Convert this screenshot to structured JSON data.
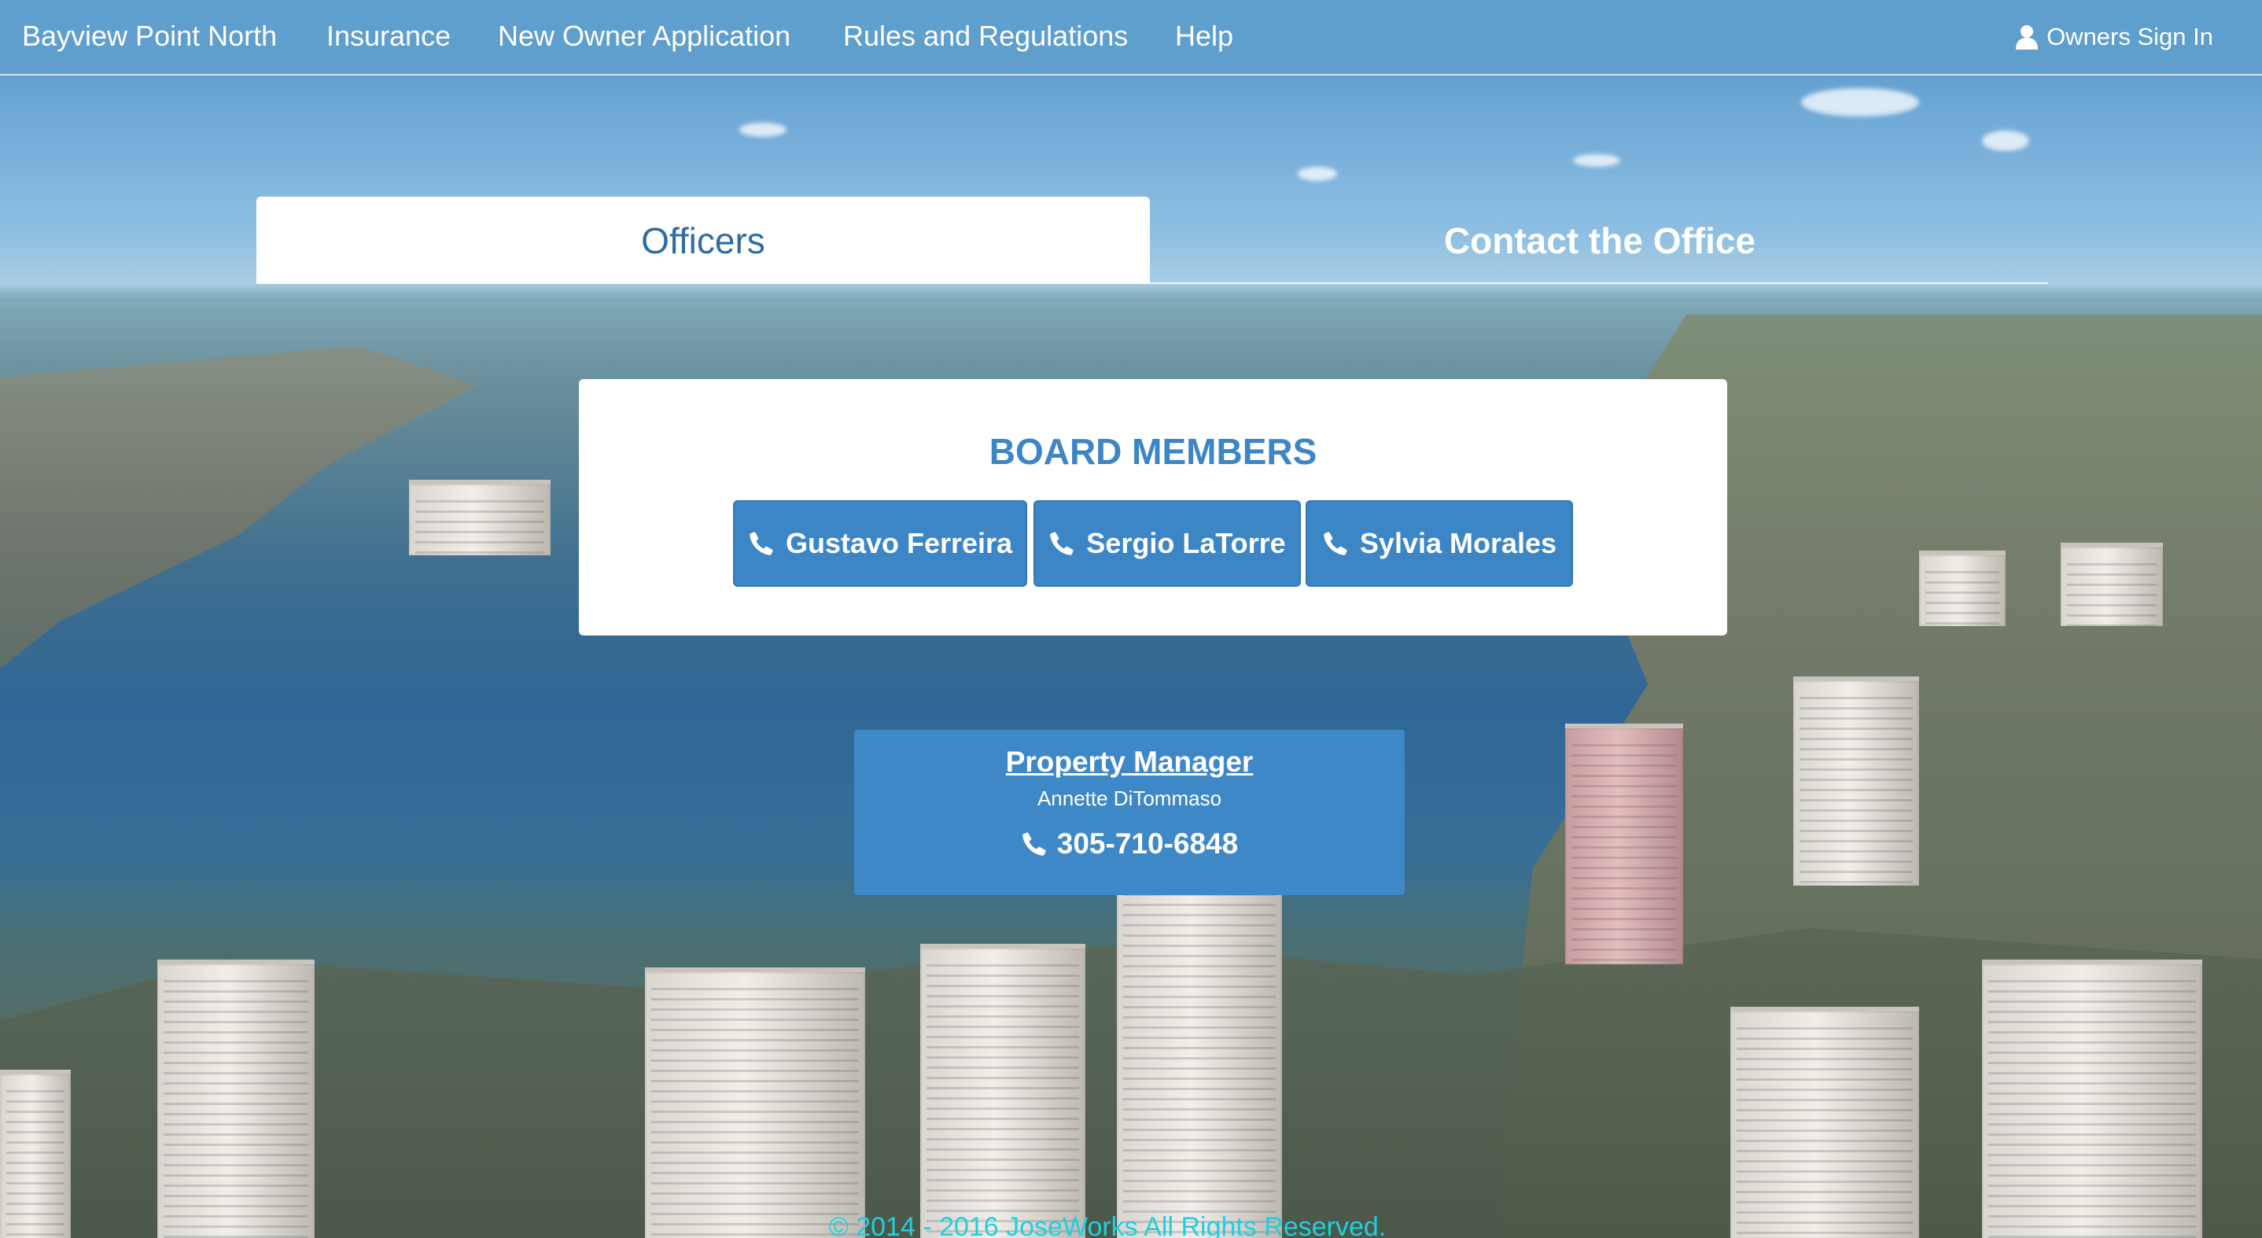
{
  "navbar": {
    "brand": "Bayview Point North",
    "links": [
      "Insurance",
      "New Owner Application",
      "Rules and Regulations",
      "Help"
    ],
    "signin_label": "Owners Sign In",
    "signin_icon": "user-icon",
    "background": "#5fa0cd"
  },
  "tabs": {
    "active": "Officers",
    "inactive": "Contact the Office"
  },
  "board": {
    "title": "BOARD MEMBERS",
    "members": [
      "Gustavo Ferreira",
      "Sergio LaTorre",
      "Sylvia Morales"
    ],
    "button_icon": "phone-icon",
    "accent": "#3c86c6"
  },
  "property_manager": {
    "title": "Property Manager",
    "name": "Annette DiTommaso",
    "phone": "305-710-6848",
    "phone_icon": "phone-icon"
  },
  "footer": {
    "text": "© 2014 - 2016 JoseWorks All Rights Reserved.",
    "color": "#1fd0e0"
  }
}
